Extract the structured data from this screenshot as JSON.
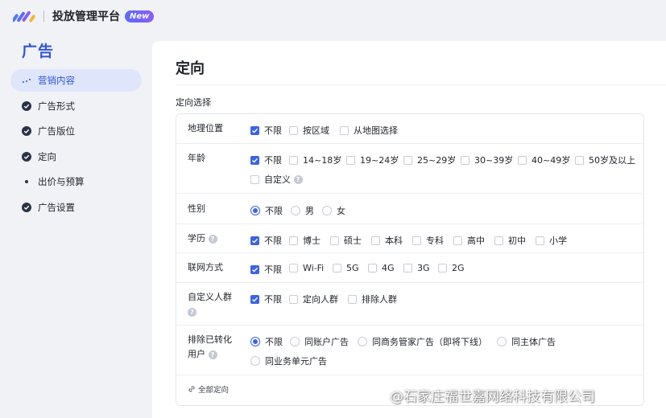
{
  "header": {
    "app_title": "投放管理平台",
    "badge": "New"
  },
  "sidebar": {
    "title": "广告",
    "items": [
      {
        "label": "营销内容",
        "icon": "dots-icon",
        "state": "active"
      },
      {
        "label": "广告形式",
        "icon": "check-circle-icon",
        "state": "done"
      },
      {
        "label": "广告版位",
        "icon": "check-circle-icon",
        "state": "done"
      },
      {
        "label": "定向",
        "icon": "check-circle-icon",
        "state": "done"
      },
      {
        "label": "出价与预算",
        "icon": "dot-icon",
        "state": "pending"
      },
      {
        "label": "广告设置",
        "icon": "check-circle-icon",
        "state": "done"
      }
    ]
  },
  "main": {
    "title": "定向",
    "section_label": "定向选择",
    "rows": [
      {
        "label": "地理位置",
        "options": [
          "不限",
          "按区域",
          "从地图选择"
        ],
        "checked": "不限"
      },
      {
        "label": "年龄",
        "options": [
          "不限",
          "14~18岁",
          "19~24岁",
          "25~29岁",
          "30~39岁",
          "40~49岁",
          "50岁及以上",
          "自定义"
        ],
        "checked": "不限"
      },
      {
        "label": "性别",
        "options": [
          "不限",
          "男",
          "女"
        ],
        "checked": "不限"
      },
      {
        "label": "学历",
        "options": [
          "不限",
          "博士",
          "硕士",
          "本科",
          "专科",
          "高中",
          "初中",
          "小学"
        ],
        "checked": "不限"
      },
      {
        "label": "联网方式",
        "options": [
          "不限",
          "Wi-Fi",
          "5G",
          "4G",
          "3G",
          "2G"
        ],
        "checked": "不限"
      },
      {
        "label": "自定义人群",
        "options": [
          "不限",
          "定向人群",
          "排除人群"
        ],
        "checked": "不限"
      },
      {
        "label": "排除已转化",
        "label_line2": "用户",
        "options": [
          "不限",
          "同账户广告",
          "同商务管家广告（即将下线）",
          "同主体广告",
          "同业务单元广告"
        ],
        "checked": "不限"
      }
    ],
    "footer_link": "全部定向"
  },
  "watermark": "@石家庄福世嘉网络科技有限公司",
  "colors": {
    "accent": "#3b63e6",
    "sidebar_title": "#2f56d8",
    "active_bg": "#dfe6fb"
  }
}
